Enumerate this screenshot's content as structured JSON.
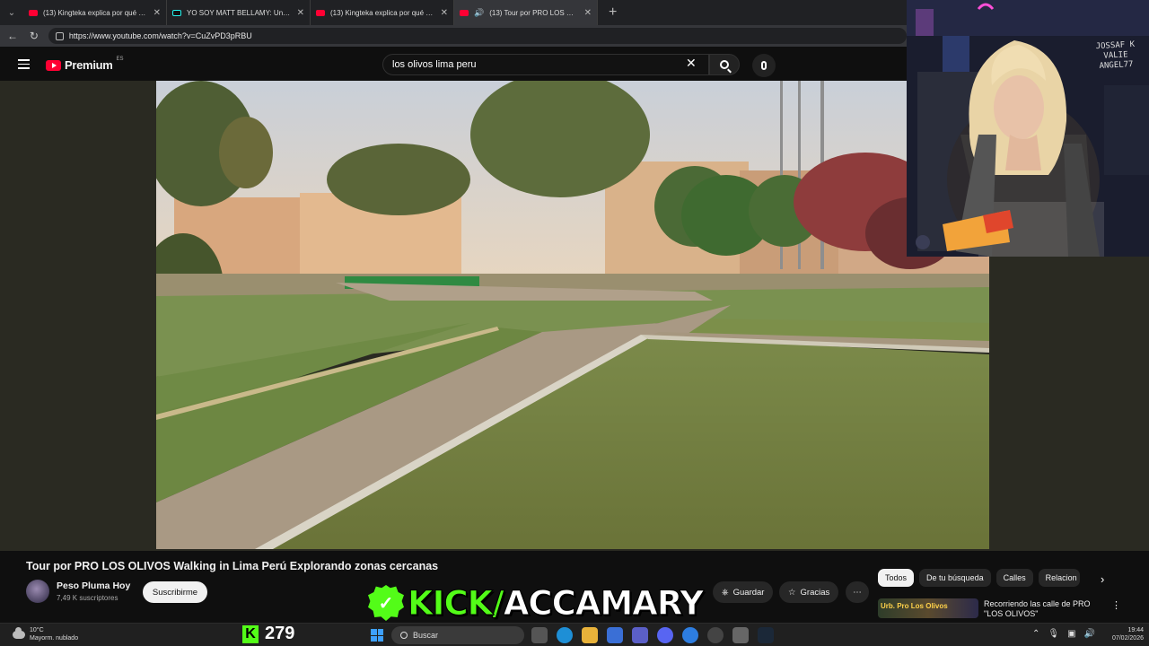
{
  "browser": {
    "tabs": [
      {
        "title": "(13) Kingteka explica por qué ya n",
        "favicon": "youtube-icon",
        "active": false
      },
      {
        "title": "YO SOY MATT BELLAMY: Un Show",
        "favicon": "tiktok-icon",
        "active": false
      },
      {
        "title": "(13) Kingteka explica por qué ya n",
        "favicon": "youtube-icon",
        "active": false
      },
      {
        "title": "(13) Tour por PRO LOS OLIVOS",
        "favicon": "youtube-icon",
        "active": true
      }
    ],
    "new_tab_label": "+",
    "url": "https://www.youtube.com/watch?v=CuZvPD3pRBU"
  },
  "youtube": {
    "logo_text": "Premium",
    "region_code": "ES",
    "search_query": "los olivos lima peru",
    "video": {
      "title": "Tour por PRO LOS OLIVOS Walking in Lima Perú Explorando zonas cercanas",
      "channel": "Peso Pluma Hoy",
      "subscribers": "7,49 K suscriptores",
      "subscribe_label": "Suscribirme",
      "save_label": "Guardar",
      "thanks_label": "Gracias"
    },
    "chips": [
      "Todos",
      "De tu búsqueda",
      "Calles",
      "Relacion"
    ],
    "recommendation": {
      "thumb_text": "Urb. Pro Los Olivos",
      "title": "Recorriendo las calle de PRO \"LOS OLIVOS\""
    }
  },
  "overlay": {
    "kick_prefix": "KICK/",
    "kick_user": "ACCAMARY",
    "webcam_sign": "JOSSAF K VALIE ANGEL77"
  },
  "taskbar": {
    "temperature": "10°C",
    "weather": "Mayorm. nublado",
    "kick_viewers": "279",
    "search_label": "Buscar",
    "time": "19:44",
    "date": "07/02/2026"
  }
}
